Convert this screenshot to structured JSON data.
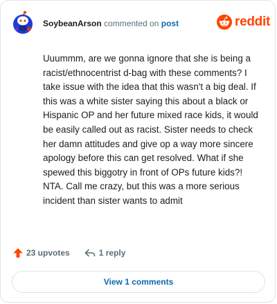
{
  "header": {
    "username": "SoybeanArson",
    "verb": "commented on",
    "target": "post",
    "brand_name": "reddit"
  },
  "comment": {
    "text": "Uuummm, are we gonna ignore that she is being a racist/ethnocentrist d-bag with these comments? I take issue with the idea that this wasn't a big deal. If this was a white sister saying this about a black or Hispanic OP and her future mixed race kids, it would be easily called out as racist. Sister needs to check her damn attitudes and give op a way more sincere apology before this can get resolved. What if she spewed this biggotry in front of OPs future kids?! NTA. Call me crazy, but this was a more serious incident than sister wants to admit"
  },
  "actions": {
    "upvotes": "23 upvotes",
    "replies": "1 reply"
  },
  "footer": {
    "view_comments": "View 1 comments"
  },
  "colors": {
    "accent": "#ff4500",
    "link": "#0a6ab0",
    "muted": "#576f76",
    "avatar": "#1d3fd6"
  },
  "icons": {
    "avatar": "snoo-avatar-icon",
    "brand": "reddit-logo-icon",
    "upvote": "upvote-arrow-icon",
    "reply": "reply-arrow-icon"
  }
}
